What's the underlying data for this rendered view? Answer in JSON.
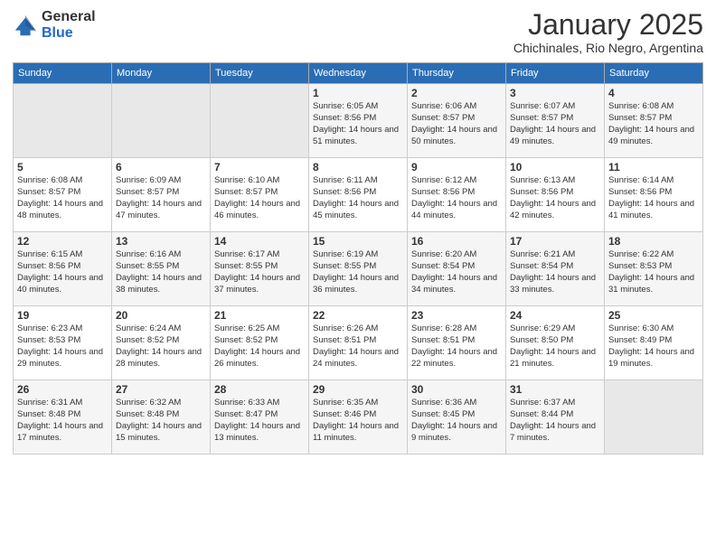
{
  "logo": {
    "general": "General",
    "blue": "Blue"
  },
  "title": "January 2025",
  "subtitle": "Chichinales, Rio Negro, Argentina",
  "days_of_week": [
    "Sunday",
    "Monday",
    "Tuesday",
    "Wednesday",
    "Thursday",
    "Friday",
    "Saturday"
  ],
  "weeks": [
    [
      {
        "day": "",
        "empty": true
      },
      {
        "day": "",
        "empty": true
      },
      {
        "day": "",
        "empty": true
      },
      {
        "day": "1",
        "sunrise": "6:05 AM",
        "sunset": "8:56 PM",
        "daylight": "14 hours and 51 minutes."
      },
      {
        "day": "2",
        "sunrise": "6:06 AM",
        "sunset": "8:57 PM",
        "daylight": "14 hours and 50 minutes."
      },
      {
        "day": "3",
        "sunrise": "6:07 AM",
        "sunset": "8:57 PM",
        "daylight": "14 hours and 49 minutes."
      },
      {
        "day": "4",
        "sunrise": "6:08 AM",
        "sunset": "8:57 PM",
        "daylight": "14 hours and 49 minutes."
      }
    ],
    [
      {
        "day": "5",
        "sunrise": "6:08 AM",
        "sunset": "8:57 PM",
        "daylight": "14 hours and 48 minutes."
      },
      {
        "day": "6",
        "sunrise": "6:09 AM",
        "sunset": "8:57 PM",
        "daylight": "14 hours and 47 minutes."
      },
      {
        "day": "7",
        "sunrise": "6:10 AM",
        "sunset": "8:57 PM",
        "daylight": "14 hours and 46 minutes."
      },
      {
        "day": "8",
        "sunrise": "6:11 AM",
        "sunset": "8:56 PM",
        "daylight": "14 hours and 45 minutes."
      },
      {
        "day": "9",
        "sunrise": "6:12 AM",
        "sunset": "8:56 PM",
        "daylight": "14 hours and 44 minutes."
      },
      {
        "day": "10",
        "sunrise": "6:13 AM",
        "sunset": "8:56 PM",
        "daylight": "14 hours and 42 minutes."
      },
      {
        "day": "11",
        "sunrise": "6:14 AM",
        "sunset": "8:56 PM",
        "daylight": "14 hours and 41 minutes."
      }
    ],
    [
      {
        "day": "12",
        "sunrise": "6:15 AM",
        "sunset": "8:56 PM",
        "daylight": "14 hours and 40 minutes."
      },
      {
        "day": "13",
        "sunrise": "6:16 AM",
        "sunset": "8:55 PM",
        "daylight": "14 hours and 38 minutes."
      },
      {
        "day": "14",
        "sunrise": "6:17 AM",
        "sunset": "8:55 PM",
        "daylight": "14 hours and 37 minutes."
      },
      {
        "day": "15",
        "sunrise": "6:19 AM",
        "sunset": "8:55 PM",
        "daylight": "14 hours and 36 minutes."
      },
      {
        "day": "16",
        "sunrise": "6:20 AM",
        "sunset": "8:54 PM",
        "daylight": "14 hours and 34 minutes."
      },
      {
        "day": "17",
        "sunrise": "6:21 AM",
        "sunset": "8:54 PM",
        "daylight": "14 hours and 33 minutes."
      },
      {
        "day": "18",
        "sunrise": "6:22 AM",
        "sunset": "8:53 PM",
        "daylight": "14 hours and 31 minutes."
      }
    ],
    [
      {
        "day": "19",
        "sunrise": "6:23 AM",
        "sunset": "8:53 PM",
        "daylight": "14 hours and 29 minutes."
      },
      {
        "day": "20",
        "sunrise": "6:24 AM",
        "sunset": "8:52 PM",
        "daylight": "14 hours and 28 minutes."
      },
      {
        "day": "21",
        "sunrise": "6:25 AM",
        "sunset": "8:52 PM",
        "daylight": "14 hours and 26 minutes."
      },
      {
        "day": "22",
        "sunrise": "6:26 AM",
        "sunset": "8:51 PM",
        "daylight": "14 hours and 24 minutes."
      },
      {
        "day": "23",
        "sunrise": "6:28 AM",
        "sunset": "8:51 PM",
        "daylight": "14 hours and 22 minutes."
      },
      {
        "day": "24",
        "sunrise": "6:29 AM",
        "sunset": "8:50 PM",
        "daylight": "14 hours and 21 minutes."
      },
      {
        "day": "25",
        "sunrise": "6:30 AM",
        "sunset": "8:49 PM",
        "daylight": "14 hours and 19 minutes."
      }
    ],
    [
      {
        "day": "26",
        "sunrise": "6:31 AM",
        "sunset": "8:48 PM",
        "daylight": "14 hours and 17 minutes."
      },
      {
        "day": "27",
        "sunrise": "6:32 AM",
        "sunset": "8:48 PM",
        "daylight": "14 hours and 15 minutes."
      },
      {
        "day": "28",
        "sunrise": "6:33 AM",
        "sunset": "8:47 PM",
        "daylight": "14 hours and 13 minutes."
      },
      {
        "day": "29",
        "sunrise": "6:35 AM",
        "sunset": "8:46 PM",
        "daylight": "14 hours and 11 minutes."
      },
      {
        "day": "30",
        "sunrise": "6:36 AM",
        "sunset": "8:45 PM",
        "daylight": "14 hours and 9 minutes."
      },
      {
        "day": "31",
        "sunrise": "6:37 AM",
        "sunset": "8:44 PM",
        "daylight": "14 hours and 7 minutes."
      },
      {
        "day": "",
        "empty": true
      }
    ]
  ]
}
